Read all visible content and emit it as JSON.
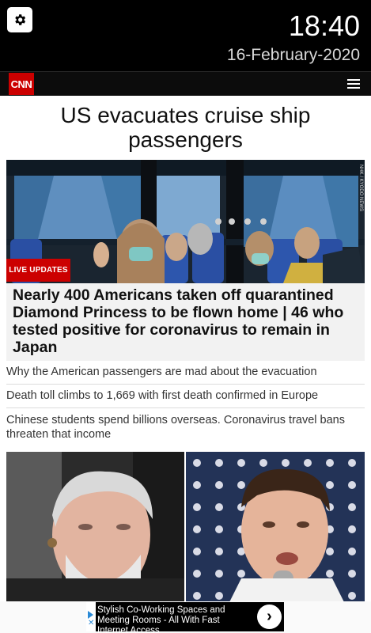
{
  "status": {
    "time": "18:40",
    "date": "16-February-2020"
  },
  "header": {
    "logo_text": "CNN",
    "brand_color": "#cc0000"
  },
  "main": {
    "headline": "US evacuates cruise ship passengers",
    "hero_credit": "NHK / KYODO NEWS",
    "live_badge": "LIVE UPDATES",
    "lead_story": "Nearly 400 Americans taken off quarantined Diamond Princess to be flown home | 46 who tested positive for coronavirus to remain in Japan",
    "stories": [
      "Why the American passengers are mad about the evacuation",
      "Death toll climbs to 1,669 with first death confirmed in Europe",
      "Chinese students spend billions overseas. Coronavirus travel bans threaten that income"
    ]
  },
  "ad": {
    "text": "Stylish Co-Working Spaces and Meeting Rooms - All With Fast Internet Access",
    "arrow": "›",
    "close": "✕"
  },
  "icons": {
    "settings": "gear-icon",
    "menu": "hamburger-menu-icon",
    "ad_arrow": "chevron-right-icon",
    "ad_choices": "ad-choices-icon"
  }
}
